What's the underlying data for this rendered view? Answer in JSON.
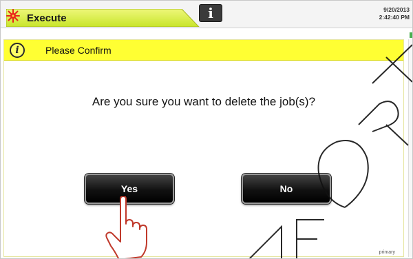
{
  "header": {
    "tab_label": "Execute",
    "tab_icon": "laser-burst-icon",
    "info_label": "i",
    "date": "9/20/2013",
    "time": "2:42:40 PM"
  },
  "dialog": {
    "icon": "info-circle-icon",
    "title": "Please Confirm",
    "message": "Are you sure you want to delete the job(s)?",
    "yes_label": "Yes",
    "no_label": "No",
    "footer_text": "primary"
  },
  "overlay": {
    "cursor": "hand-pointer-icon",
    "watermark": "UNIFORM"
  },
  "colors": {
    "header_yellow": "#ffff33",
    "tab_yellow_green": "#d8ef3c",
    "burst_red": "#e8231a",
    "button_black": "#111111",
    "hand_red": "#c0392b"
  }
}
